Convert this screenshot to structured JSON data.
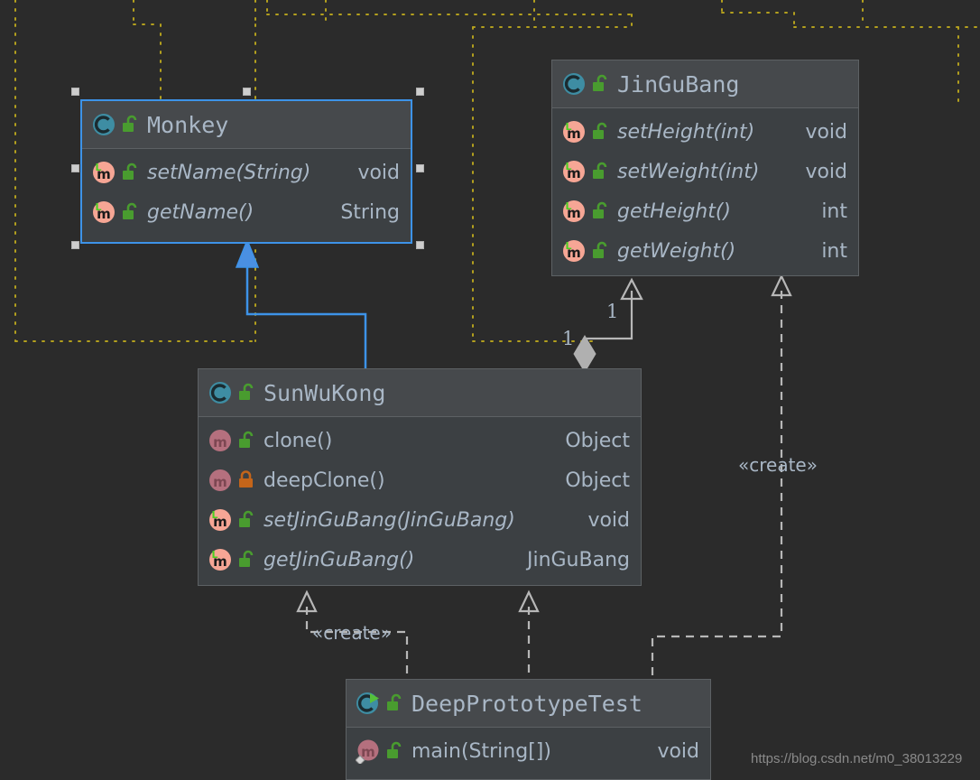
{
  "diagram": {
    "kind": "uml-class-diagram",
    "background_color": "#2b2b2b",
    "guide_color": "#b3a01e",
    "selection_color": "#3d93e8",
    "link_color": "#b7b7b7",
    "text_color": "#a9b7c6"
  },
  "classes": {
    "monkey": {
      "name": "Monkey",
      "icon": "class-icon",
      "visibility_icon": "unlocked-green-icon",
      "selected": true,
      "members": [
        {
          "icon": "abstract-method-icon",
          "lock": "unlocked-green-icon",
          "signature": "setName(String)",
          "return": "void",
          "italic": true
        },
        {
          "icon": "abstract-method-icon",
          "lock": "unlocked-green-icon",
          "signature": "getName()",
          "return": "String",
          "italic": true
        }
      ]
    },
    "jingubang": {
      "name": "JinGuBang",
      "icon": "class-icon",
      "visibility_icon": "unlocked-green-icon",
      "selected": false,
      "members": [
        {
          "icon": "abstract-method-icon",
          "lock": "unlocked-green-icon",
          "signature": "setHeight(int)",
          "return": "void",
          "italic": true
        },
        {
          "icon": "abstract-method-icon",
          "lock": "unlocked-green-icon",
          "signature": "setWeight(int)",
          "return": "void",
          "italic": true
        },
        {
          "icon": "abstract-method-icon",
          "lock": "unlocked-green-icon",
          "signature": "getHeight()",
          "return": "int",
          "italic": true
        },
        {
          "icon": "abstract-method-icon",
          "lock": "unlocked-green-icon",
          "signature": "getWeight()",
          "return": "int",
          "italic": true
        }
      ]
    },
    "sunwukong": {
      "name": "SunWuKong",
      "icon": "class-icon",
      "visibility_icon": "unlocked-green-icon",
      "selected": false,
      "members": [
        {
          "icon": "method-icon",
          "lock": "unlocked-green-icon",
          "signature": "clone()",
          "return": "Object",
          "italic": false
        },
        {
          "icon": "method-icon",
          "lock": "locked-orange-icon",
          "signature": "deepClone()",
          "return": "Object",
          "italic": false
        },
        {
          "icon": "abstract-method-icon",
          "lock": "unlocked-green-icon",
          "signature": "setJinGuBang(JinGuBang)",
          "return": "void",
          "italic": true
        },
        {
          "icon": "abstract-method-icon",
          "lock": "unlocked-green-icon",
          "signature": "getJinGuBang()",
          "return": "JinGuBang",
          "italic": true
        }
      ]
    },
    "deepprototypetest": {
      "name": "DeepPrototypeTest",
      "icon": "runnable-class-icon",
      "visibility_icon": "unlocked-green-icon",
      "selected": false,
      "members": [
        {
          "icon": "static-method-icon",
          "lock": "unlocked-green-icon",
          "signature": "main(String[])",
          "return": "void",
          "italic": false
        }
      ]
    }
  },
  "relationships": {
    "inheritance": {
      "from": "SunWuKong",
      "to": "Monkey",
      "style": "solid",
      "arrow": "filled-triangle",
      "color": "#3d93e8"
    },
    "composition": {
      "from": "SunWuKong",
      "to": "JinGuBang",
      "style": "solid",
      "arrow": "open-arrow",
      "source_decoration": "filled-diamond",
      "source_multiplicity": "1",
      "target_multiplicity": "1"
    },
    "dependencies": [
      {
        "from": "DeepPrototypeTest",
        "to": "SunWuKong",
        "style": "dashed",
        "arrow": "open-arrow",
        "label": "«create»"
      },
      {
        "from": "DeepPrototypeTest",
        "to": "SunWuKong",
        "style": "dashed",
        "arrow": "open-arrow",
        "label": ""
      },
      {
        "from": "DeepPrototypeTest",
        "to": "JinGuBang",
        "style": "dashed",
        "arrow": "open-arrow",
        "label": "«create»"
      }
    ]
  },
  "labels": {
    "create_left": "«create»",
    "create_right": "«create»",
    "mult_diamond": "1",
    "mult_arrow": "1"
  },
  "watermark": {
    "text": "https://blog.csdn.net/m0_38013229"
  }
}
